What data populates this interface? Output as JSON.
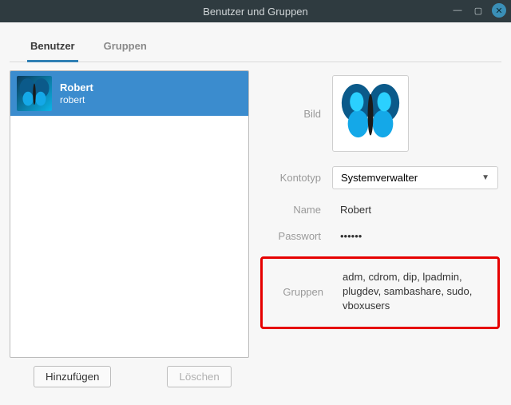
{
  "window": {
    "title": "Benutzer und Gruppen"
  },
  "tabs": {
    "users": "Benutzer",
    "groups": "Gruppen"
  },
  "users": {
    "list": [
      {
        "display_name": "Robert",
        "login": "robert"
      }
    ]
  },
  "buttons": {
    "add": "Hinzufügen",
    "delete": "Löschen"
  },
  "detail": {
    "labels": {
      "picture": "Bild",
      "account_type": "Kontotyp",
      "name": "Name",
      "password": "Passwort",
      "groups": "Gruppen"
    },
    "account_type_value": "Systemverwalter",
    "name_value": "Robert",
    "password_masked": "••••••",
    "groups_value": "adm, cdrom, dip, lpadmin, plugdev, sambashare, sudo, vboxusers"
  }
}
